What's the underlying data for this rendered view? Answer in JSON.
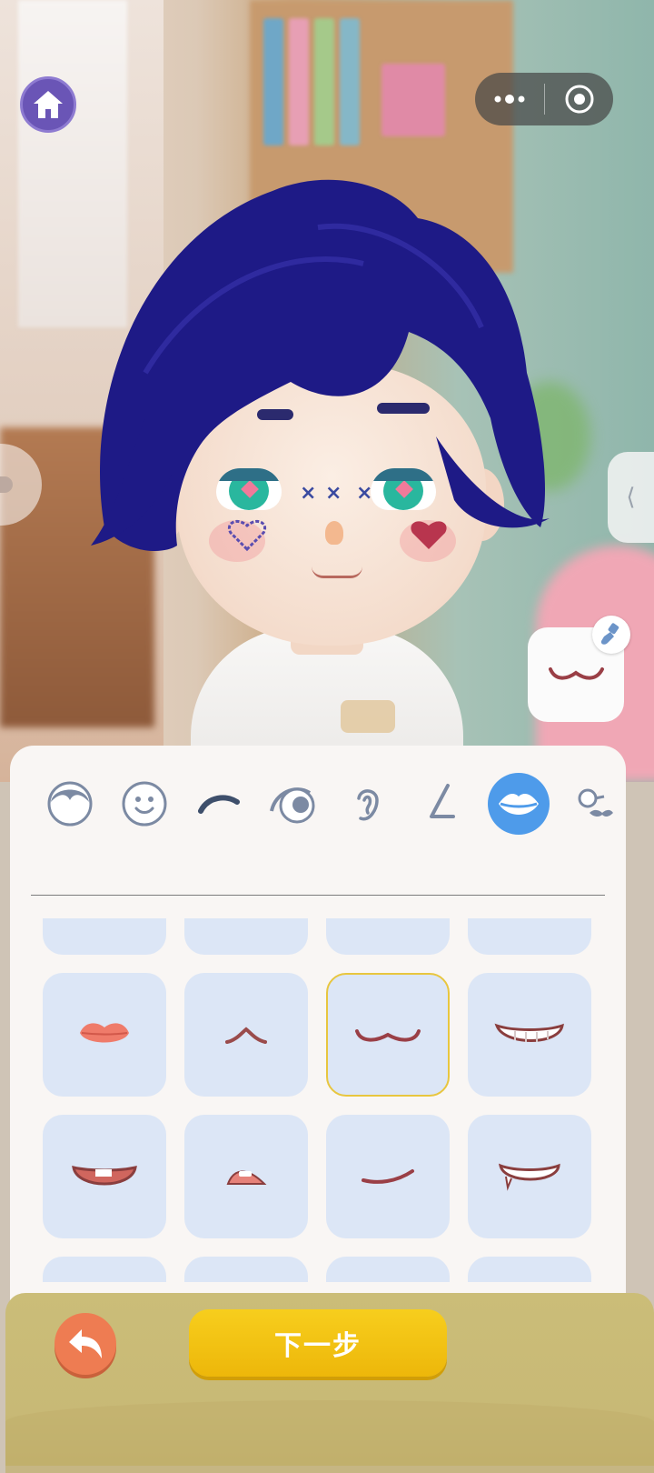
{
  "top_bar": {
    "home_icon": "home-icon",
    "capsule_more_icon": "more-dots-icon",
    "capsule_close_icon": "target-close-icon"
  },
  "side_controls": {
    "right_tab_icon": "chevron-left-icon",
    "right_tab_glyph": "⟨",
    "brush_icon": "brush-icon",
    "selected_preview": "mouth-wavy"
  },
  "categories": [
    {
      "name": "face-shape",
      "icon": "head-icon",
      "active": false
    },
    {
      "name": "face",
      "icon": "smiley-icon",
      "active": false
    },
    {
      "name": "eyebrow",
      "icon": "eyebrow-icon",
      "active": false
    },
    {
      "name": "eye",
      "icon": "eye-icon",
      "active": false
    },
    {
      "name": "ear",
      "icon": "ear-icon",
      "active": false
    },
    {
      "name": "nose",
      "icon": "nose-icon",
      "active": false
    },
    {
      "name": "mouth",
      "icon": "lips-icon",
      "active": true
    },
    {
      "name": "accessory",
      "icon": "glasses-mustache-icon",
      "active": false
    }
  ],
  "mouth_options": [
    {
      "id": "lips-red",
      "selected": false
    },
    {
      "id": "caret-smile",
      "selected": false
    },
    {
      "id": "wavy",
      "selected": true
    },
    {
      "id": "toothy-grin",
      "selected": false
    },
    {
      "id": "open-smile",
      "selected": false
    },
    {
      "id": "small-open",
      "selected": false
    },
    {
      "id": "smirk",
      "selected": false
    },
    {
      "id": "fang-smile",
      "selected": false
    }
  ],
  "footer": {
    "back_icon": "back-arrow-icon",
    "next_label": "下一步"
  },
  "colors": {
    "hair": "#1e1a86",
    "accent_active": "#4e9bea",
    "tile_bg": "#dce6f6",
    "selected_border": "#e8c63f",
    "next_button": "#f2c311",
    "back_button": "#ee7c52"
  }
}
